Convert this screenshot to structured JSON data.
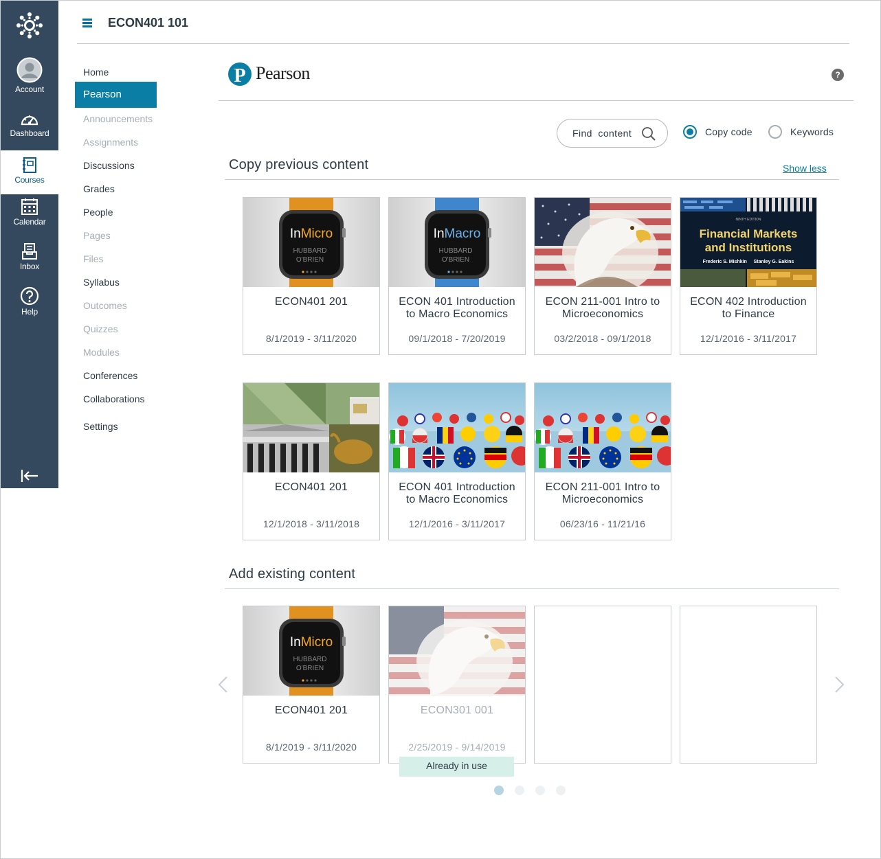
{
  "global_nav": {
    "items": [
      {
        "label": "Account",
        "icon": "avatar-icon"
      },
      {
        "label": "Dashboard",
        "icon": "dashboard-icon"
      },
      {
        "label": "Courses",
        "icon": "courses-icon",
        "active": true
      },
      {
        "label": "Calendar",
        "icon": "calendar-icon"
      },
      {
        "label": "Inbox",
        "icon": "inbox-icon"
      },
      {
        "label": "Help",
        "icon": "help-icon"
      }
    ]
  },
  "header": {
    "course_title": "ECON401 101"
  },
  "course_nav": {
    "items": [
      {
        "label": "Home",
        "disabled": false
      },
      {
        "label": "Pearson",
        "active": true
      },
      {
        "label": "Announcements",
        "disabled": true
      },
      {
        "label": "Assignments",
        "disabled": true
      },
      {
        "label": "Discussions",
        "disabled": false
      },
      {
        "label": "Grades",
        "disabled": false
      },
      {
        "label": "People",
        "disabled": false
      },
      {
        "label": "Pages",
        "disabled": true
      },
      {
        "label": "Files",
        "disabled": true
      },
      {
        "label": "Syllabus",
        "disabled": false
      },
      {
        "label": "Outcomes",
        "disabled": true
      },
      {
        "label": "Quizzes",
        "disabled": true
      },
      {
        "label": "Modules",
        "disabled": true
      },
      {
        "label": "Conferences",
        "disabled": false
      },
      {
        "label": "Collaborations",
        "disabled": false
      },
      {
        "label": "Settings",
        "disabled": false
      }
    ]
  },
  "pearson": {
    "brand": "Pearson",
    "logo_letter": "P",
    "help": "?"
  },
  "search": {
    "find_label": "Find  content",
    "options": [
      {
        "label": "Copy code",
        "selected": true
      },
      {
        "label": "Keywords",
        "selected": false
      }
    ]
  },
  "copy_previous": {
    "title": "Copy previous content",
    "show_less": "Show less",
    "cards": [
      {
        "title": "ECON401 201",
        "dates": "8/1/2019 - 3/11/2020",
        "cover": "micro"
      },
      {
        "title": "ECON 401 Introduction to Macro Economics",
        "dates": "09/1/2018 - 7/20/2019",
        "cover": "macro"
      },
      {
        "title": "ECON 211-001 Intro to Microeconomics",
        "dates": "03/2/2018 - 09/1/2018",
        "cover": "eagle"
      },
      {
        "title": "ECON 402 Introduction to Finance",
        "dates": "12/1/2016 - 3/11/2017",
        "cover": "finance"
      },
      {
        "title": "ECON401 201",
        "dates": "12/1/2018 - 3/11/2018",
        "cover": "exchange"
      },
      {
        "title": "ECON 401 Introduction to Macro Economics",
        "dates": "12/1/2016 - 3/11/2017",
        "cover": "flags"
      },
      {
        "title": "ECON 211-001 Intro to Microeconomics",
        "dates": "06/23/16 - 11/21/16",
        "cover": "flags"
      }
    ]
  },
  "add_existing": {
    "title": "Add existing content",
    "cards": [
      {
        "title": "ECON401 201",
        "dates": "8/1/2019 - 3/11/2020",
        "cover": "micro"
      },
      {
        "title": "ECON301 001",
        "dates": "2/25/2019 - 9/14/2019",
        "cover": "eagle",
        "in_use": true
      }
    ],
    "in_use_label": "Already in use",
    "page_dots": 4,
    "active_dot": 0
  },
  "covers": {
    "micro": {
      "brand_in": "In",
      "brand_word": "Micro",
      "authors_1": "HUBBARD",
      "authors_2": "O'BRIEN",
      "band": "#e0911f",
      "accent": "#f5a623"
    },
    "macro": {
      "brand_in": "In",
      "brand_word": "Macro",
      "authors_1": "HUBBARD",
      "authors_2": "O'BRIEN",
      "band": "#3f86cc",
      "accent": "#6bb0ea"
    },
    "finance": {
      "edition": "NINTH EDITION",
      "line1": "Financial Markets",
      "line2": "and Institutions",
      "authors": "Frederic S. Mishkin     Stanley G. Eakins"
    }
  },
  "colors": {
    "nav_bg": "#34495e",
    "accent": "#0a7ea4",
    "in_use_bg": "#d6efe8"
  }
}
